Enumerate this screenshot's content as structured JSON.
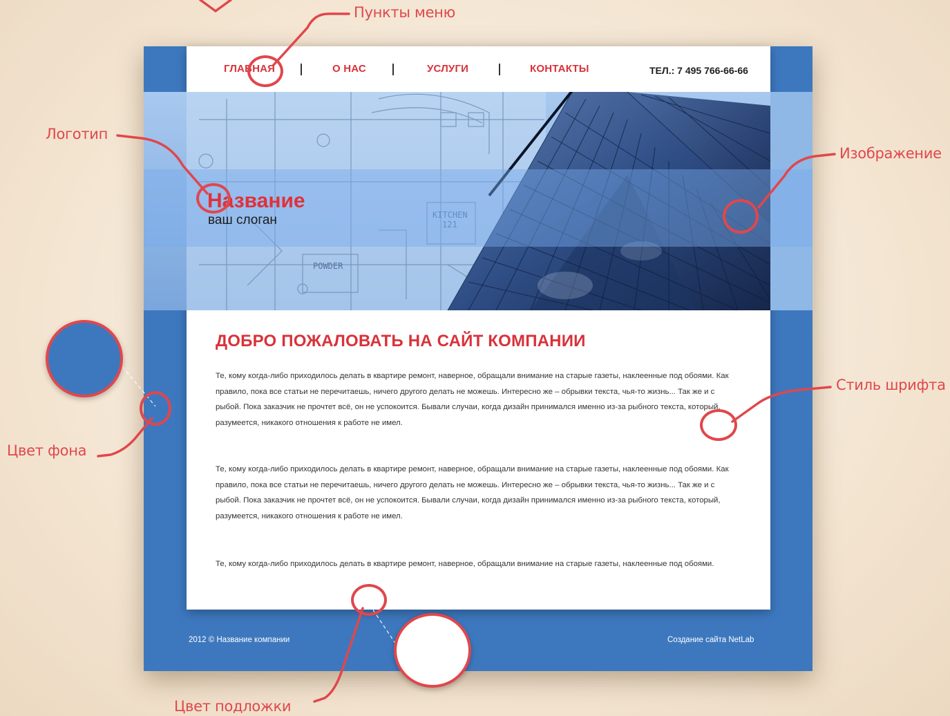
{
  "annotations": {
    "menu_items": "Пункты меню",
    "logo": "Логотип",
    "image": "Изображение",
    "font_style": "Стиль шрифта",
    "background_color": "Цвет фона",
    "backing_color": "Цвет подложки"
  },
  "site": {
    "menu": [
      {
        "label": "ГЛАВНАЯ"
      },
      {
        "label": "О НАС"
      },
      {
        "label": "УСЛУГИ"
      },
      {
        "label": "КОНТАКТЫ"
      }
    ],
    "phone": "ТЕЛ.: 7 495 766-66-66",
    "logo_title": "Название",
    "logo_slogan": "ваш слоган",
    "hero_labels": {
      "kitchen": "KITCHEN",
      "kitchen_num": "121",
      "powder": "POWDER"
    },
    "heading": "ДОБРО ПОЖАЛОВАТЬ НА САЙТ КОМПАНИИ",
    "paragraphs": [
      "Те, кому когда-либо приходилось делать в квартире ремонт, наверное, обращали внимание на старые газеты, наклеенные под обоями. Как правило, пока все статьи не перечитаешь, ничего другого делать не можешь. Интересно же – обрывки текста, чья-то жизнь... Так же и с рыбой. Пока заказчик не прочтет всё, он не успокоится. Бывали случаи, когда дизайн принимался именно из-за рыбного текста, который, разумеется, никакого отношения к работе не имел.",
      "Те, кому когда-либо приходилось делать в квартире ремонт, наверное, обращали внимание на старые газеты, наклеенные под обоями. Как правило, пока все статьи не перечитаешь, ничего другого делать не можешь. Интересно же – обрывки текста, чья-то жизнь... Так же и с рыбой. Пока заказчик не прочтет всё, он не успокоится. Бывали случаи, когда дизайн принимался именно из-за рыбного текста, который, разумеется, никакого отношения к работе не имел.",
      "Те, кому когда-либо приходилось делать в квартире ремонт, наверное, обращали внимание на старые газеты, наклеенные под обоями."
    ],
    "footer_left": "2012 © Название компании",
    "footer_right": "Создание сайта NetLab"
  },
  "colors": {
    "accent_red": "#d8323a",
    "site_blue": "#3d78bf",
    "annotation_red": "#e0474c",
    "panel_white": "#ffffff",
    "page_beige": "#f4e6d3"
  }
}
